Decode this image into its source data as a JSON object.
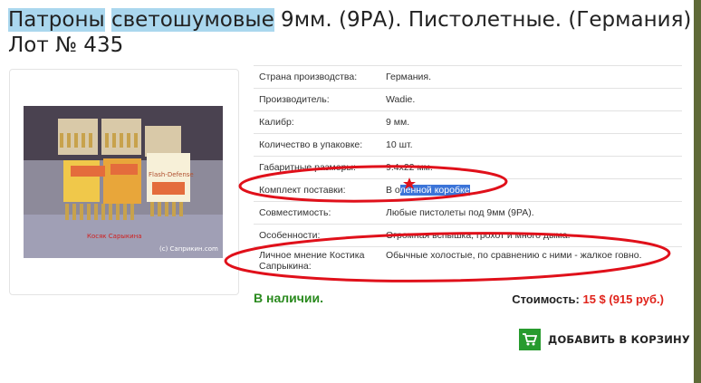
{
  "title": {
    "word1": "Патроны",
    "word2": "светошумовые",
    "rest": " 9мм. (9РА). Пистолетные. (Германия)",
    "lot": "Лот № 435"
  },
  "photo": {
    "caption_line1": "Косяк Сарыкина",
    "caption_line2": "(с) Саприкин.com",
    "box_label": "Flash-Defense"
  },
  "specs": [
    {
      "key": "Страна производства:",
      "value": "Германия."
    },
    {
      "key": "Производитель:",
      "value": "Wadie."
    },
    {
      "key": "Калибр:",
      "value": "9 мм."
    },
    {
      "key": "Количество в упаковке:",
      "value": "10 шт."
    },
    {
      "key": "Габаритные размеры:",
      "value": "9.4х22 мм."
    },
    {
      "key": "Комплект поставки:",
      "value_before": "В о",
      "value_selected": "ленной коробке "
    },
    {
      "key": "Совместимость:",
      "value": "Любые пистолеты под 9мм (9РА)."
    },
    {
      "key": "Особенности:",
      "value": "Огромная вспышка, грохот и много дыма."
    },
    {
      "key": "Личное мнение Костика Сапрыкина:",
      "value": "Обычные холостые, по сравнению с ними - жалкое говно."
    }
  ],
  "availability": "В наличии.",
  "price": {
    "label": "Стоимость:",
    "value": "15 $ (915 руб.)"
  },
  "cart_button": {
    "label": "ДОБАВИТЬ В КОРЗИНУ"
  },
  "colors": {
    "stock": "#2a8a1e",
    "price": "#e0231b",
    "cart_icon_bg": "#279b2e",
    "annotation": "#e0101a",
    "highlight": "#aad7ee"
  }
}
